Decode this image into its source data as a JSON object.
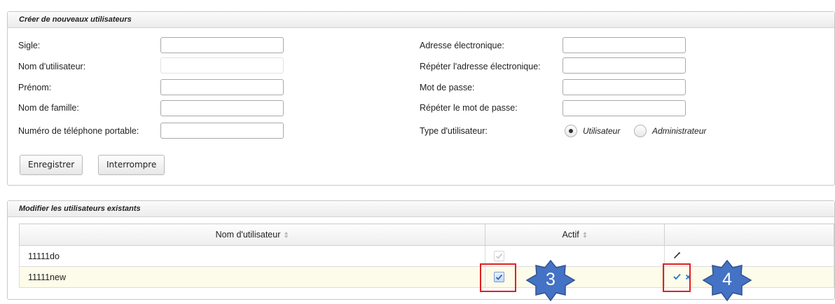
{
  "create_panel": {
    "title": "Créer de nouveaux utilisateurs",
    "fields_left": [
      {
        "label": "Sigle:",
        "value": ""
      },
      {
        "label": "Nom d'utilisateur:",
        "value": ""
      },
      {
        "label": "Prénom:",
        "value": ""
      },
      {
        "label": "Nom de famille:",
        "value": ""
      },
      {
        "label": "Numéro de téléphone portable:",
        "value": ""
      }
    ],
    "fields_right": [
      {
        "label": "Adresse électronique:",
        "value": ""
      },
      {
        "label": "Répéter l'adresse électronique:",
        "value": ""
      },
      {
        "label": "Mot de passe:",
        "value": ""
      },
      {
        "label": "Répéter le mot de passe:",
        "value": ""
      }
    ],
    "user_type": {
      "label": "Type d'utilisateur:",
      "options": [
        "Utilisateur",
        "Administrateur"
      ],
      "selected": "Utilisateur"
    },
    "save_label": "Enregistrer",
    "cancel_label": "Interrompre"
  },
  "edit_panel": {
    "title": "Modifier les utilisateurs existants",
    "columns": [
      "Nom d'utilisateur",
      "Actif",
      ""
    ],
    "sort_icon": "⇕",
    "rows": [
      {
        "username": "11111do",
        "active": true,
        "active_enabled": false,
        "actions": [
          "edit-icon"
        ]
      },
      {
        "username": "11111new",
        "active": true,
        "active_enabled": true,
        "actions": [
          "confirm-icon",
          "cancel-icon"
        ]
      }
    ]
  },
  "callouts": [
    "3",
    "4"
  ],
  "colors": {
    "callout_fill": "#4472c4",
    "highlight_box": "#e02020",
    "row_highlight": "#fdfbe9"
  }
}
